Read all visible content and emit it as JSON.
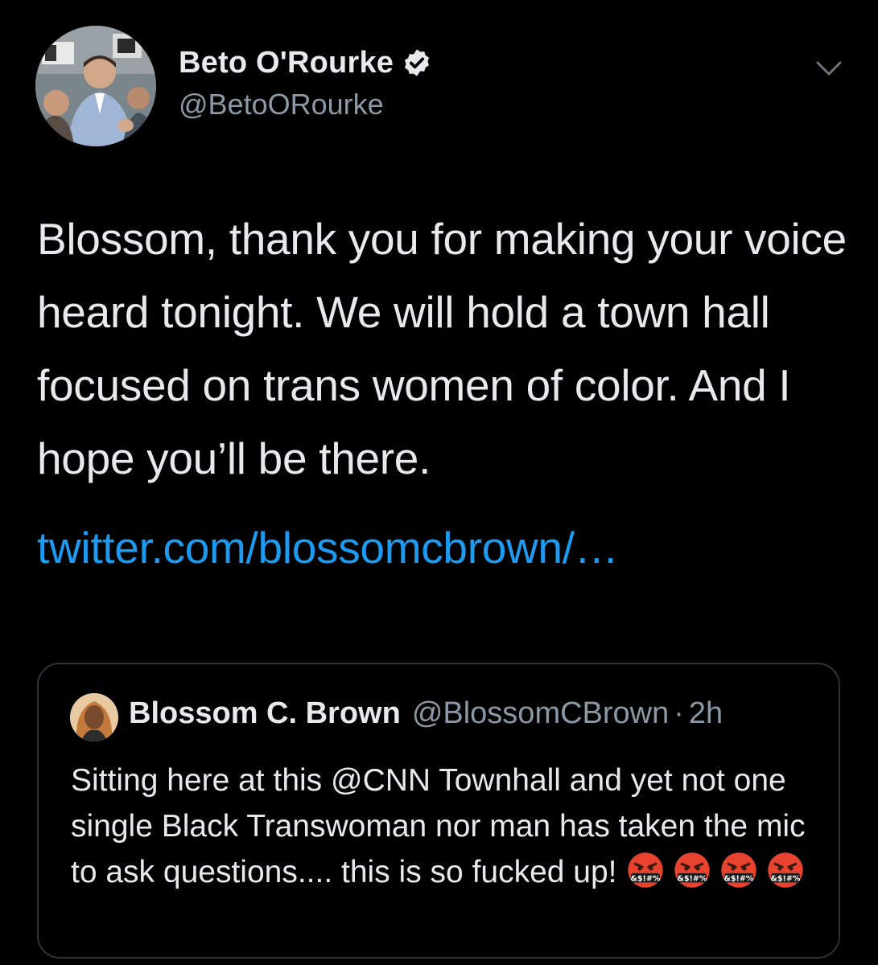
{
  "tweet": {
    "author": {
      "display_name": "Beto O'Rourke",
      "handle": "@BetoORourke",
      "verified": true,
      "avatar_icon": "profile-photo"
    },
    "menu_icon": "chevron-down-icon",
    "text": "Blossom, thank you for making your voice heard tonight. We will hold a town hall focused on trans women of color. And I hope you’ll be there.",
    "link": "twitter.com/blossomcbrown/…",
    "quoted": {
      "author": {
        "display_name": "Blossom C. Brown",
        "handle": "@BlossomCBrown",
        "separator": "·",
        "time": "2h",
        "avatar_icon": "profile-photo"
      },
      "text": "Sitting here at this @CNN Townhall and yet not one single Black Transwoman nor man has taken the mic to ask questions.... this is so fucked up!",
      "emoji": [
        "face-with-symbols-on-mouth",
        "face-with-symbols-on-mouth",
        "face-with-symbols-on-mouth",
        "face-with-symbols-on-mouth"
      ]
    }
  },
  "colors": {
    "background": "#000000",
    "text": "#e7e9ea",
    "secondary_text": "#8b98a5",
    "link": "#1d9bf0",
    "border": "#2f3336"
  }
}
